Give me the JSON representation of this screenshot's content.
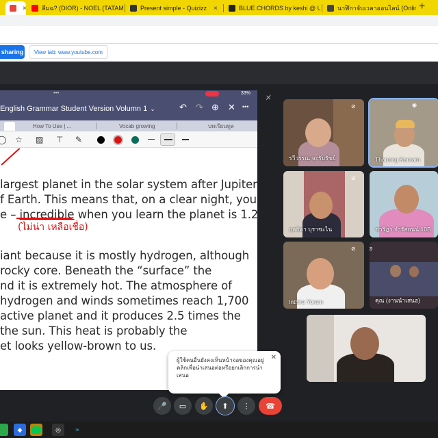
{
  "browser": {
    "tabs": [
      {
        "title": "",
        "close": "×",
        "color": "#e8453c"
      },
      {
        "title": "ลืมฉ? (DIOR) - NOEL (TATAMI",
        "close": "×",
        "color": "#ff0000"
      },
      {
        "title": "Present simple - Quizizz",
        "close": "×",
        "color": "#333333"
      },
      {
        "title": "BLUE CHORDS by keshi @ Ultim",
        "close": "×",
        "color": "#222222"
      },
      {
        "title": "นาฬิกาจับเวลาออนไลน์ (Online Stop",
        "close": "×",
        "color": "#444444"
      }
    ],
    "new_tab": "+"
  },
  "share_bar": {
    "sharing_label": "sharing",
    "view_tab_label": "View tab: www.youtube.com"
  },
  "shared_screen": {
    "status_dots": "•••",
    "battery": "33%",
    "doc_title": "English Grammar Student Version Volumn 1",
    "title_chevron": "⌄",
    "icons": {
      "undo": "↶",
      "redo": "↷",
      "add_page": "⊕",
      "close": "✕",
      "more": "•••"
    },
    "doc_tabs": [
      "",
      "How To Use | ...",
      "Vocab growing",
      "",
      "บทเรียนทูล"
    ],
    "text_lines": [
      {
        "pre": " largest planet in the solar system after Jupiter",
        "u": "",
        "post": ""
      },
      {
        "pre": "f Earth. This means that, on a clear night, you c",
        "u": "",
        "post": ""
      },
      {
        "pre": "e – ",
        "u": "incredible",
        "post": " when you learn the planet is 1.2"
      },
      {
        "pre": "iant because it is mostly hydrogen, although",
        "u": "",
        "post": ""
      },
      {
        "pre": "rocky core. Beneath the “surface” the",
        "u": "",
        "post": ""
      },
      {
        "pre": "nd it is extremely hot. The atmosphere of",
        "u": "",
        "post": ""
      },
      {
        "pre": " hydrogen and winds sometimes reach 1,700",
        "u": "",
        "post": ""
      },
      {
        "pre": "active planet and it produces 2.5 times the",
        "u": "",
        "post": ""
      },
      {
        "pre": " the sun. This heat is probably the",
        "u": "",
        "post": ""
      },
      {
        "pre": "et looks yellow-brown to us.",
        "u": "",
        "post": ""
      }
    ],
    "annotation": "(ไม่น่า เหลือเชื่อ)"
  },
  "participants": [
    {
      "name": "รวีวรรณ จะรับรัชย์",
      "muted": true
    },
    {
      "name": "Thanong Kanram",
      "muted": false
    },
    {
      "name": "กุลธิดา บุราชะไน",
      "muted": true
    },
    {
      "name": "ชาริฎา จำรัสอนน์ 10B",
      "muted": false
    },
    {
      "name": "Inthira Yoram",
      "muted": true
    },
    {
      "name": "คุณ (งานนำเสนอ)",
      "muted": false
    },
    {
      "name": "",
      "muted": false
    }
  ],
  "popup": {
    "message": "ผู้ใช้คนอื่นยังคงเห็นหน้าจอของคุณอยู่ คลิกเพื่อนำเสนอต่อหรือยกเลิกการนำเสนอ",
    "close": "✕"
  },
  "controls": {
    "mic": "🎤",
    "camera": "▭",
    "hand": "✋",
    "present": "⬆",
    "more": "⋮",
    "end": "☎"
  },
  "colors": {
    "tab_strip": "#f2d600",
    "meet_bg": "#202124",
    "share_blue": "#1a73e8",
    "end_call": "#ea4335",
    "doc_header": "#4a4f72"
  }
}
